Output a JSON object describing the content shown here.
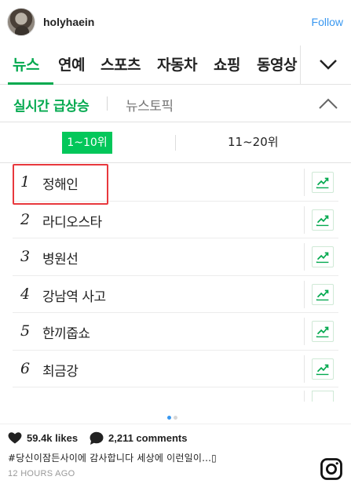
{
  "post": {
    "username": "holyhaein",
    "follow_label": "Follow",
    "likes": "59.4k likes",
    "comments": "2,211 comments",
    "caption": "#당신이잠든사이에 감사합니다 세상에 이런일이...▯",
    "time": "12 HOURS AGO"
  },
  "naver": {
    "tabs": [
      "뉴스",
      "연예",
      "스포츠",
      "자동차",
      "쇼핑",
      "동영상"
    ],
    "subtabs": {
      "realtime": "실시간 급상승",
      "topic": "뉴스토픽"
    },
    "rank_ranges": [
      "1~10위",
      "11~20위"
    ],
    "items": [
      {
        "rank": "1",
        "keyword": "정해인"
      },
      {
        "rank": "2",
        "keyword": "라디오스타"
      },
      {
        "rank": "3",
        "keyword": "병원선"
      },
      {
        "rank": "4",
        "keyword": "강남역 사고"
      },
      {
        "rank": "5",
        "keyword": "한끼줍쇼"
      },
      {
        "rank": "6",
        "keyword": "최금강"
      }
    ]
  },
  "colors": {
    "naver_green": "#03a94f",
    "highlight_red": "#e8383d",
    "instagram_blue": "#3897f0"
  },
  "icons": [
    "avatar",
    "chevron-down-icon",
    "chevron-up-icon",
    "trend-chart-icon",
    "heart-icon",
    "comment-icon",
    "instagram-logo-icon"
  ]
}
